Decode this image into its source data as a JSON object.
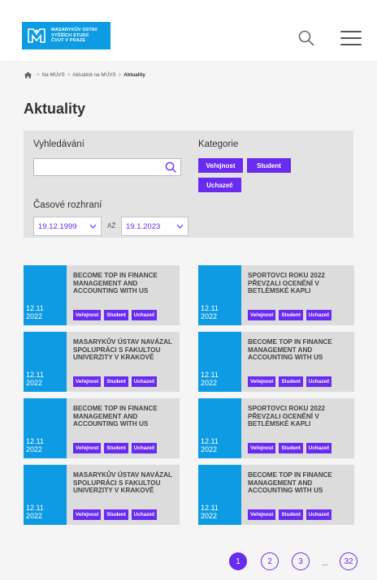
{
  "header": {
    "logo_lines": [
      "MASARYKŮV ÚSTAV",
      "VYŠŠÍCH STUDIÍ",
      "ČVUT V PRAZE"
    ],
    "search_icon": "search-icon",
    "menu_icon": "hamburger-menu-icon"
  },
  "breadcrumb": {
    "items": [
      "Na MÚVS",
      "Aktuálně na MÚVS",
      "Aktuality"
    ],
    "home_icon": "home-icon"
  },
  "page": {
    "title": "Aktuality"
  },
  "filter": {
    "search_label": "Vyhledávání",
    "search_value": "",
    "category_label": "Kategorie",
    "categories": [
      "Veřejnost",
      "Student",
      "Uchazeč"
    ],
    "time_label": "Časové rozhraní",
    "date_from": "19.12.1999",
    "date_to_label": "AŽ",
    "date_to": "19.1.2023"
  },
  "news": [
    {
      "day": "12.11",
      "year": "2022",
      "title": "BECOME TOP IN FINANCE MANAGEMENT AND ACCOUNTING WITH US",
      "tags": [
        "Veřejnost",
        "Student",
        "Uchazeč"
      ]
    },
    {
      "day": "12.11",
      "year": "2022",
      "title": "SPORTOVCI ROKU 2022 PŘEVZALI OCENĚNÍ V BETLÉMSKÉ KAPLI",
      "tags": [
        "Veřejnost",
        "Student",
        "Uchazeč"
      ]
    },
    {
      "day": "12.11",
      "year": "2022",
      "title": "MASARYKŮV ÚSTAV NAVÁZAL SPOLUPRÁCI S FAKULTOU UNIVERZITY V KRAKOVĚ",
      "tags": [
        "Veřejnost",
        "Student",
        "Uchazeč"
      ]
    },
    {
      "day": "12.11",
      "year": "2022",
      "title": "BECOME TOP IN FINANCE MANAGEMENT AND ACCOUNTING WITH US",
      "tags": [
        "Veřejnost",
        "Student",
        "Uchazeč"
      ]
    },
    {
      "day": "12.11",
      "year": "2022",
      "title": "BECOME TOP IN FINANCE MANAGEMENT AND ACCOUNTING WITH US",
      "tags": [
        "Veřejnost",
        "Student",
        "Uchazeč"
      ]
    },
    {
      "day": "12.11",
      "year": "2022",
      "title": "SPORTOVCI ROKU 2022 PŘEVZALI OCENĚNÍ V BETLÉMSKÉ KAPLI",
      "tags": [
        "Veřejnost",
        "Student",
        "Uchazeč"
      ]
    },
    {
      "day": "12.11",
      "year": "2022",
      "title": "MASARYKŮV ÚSTAV NAVÁZAL SPOLUPRÁCI S FAKULTOU UNIVERZITY V KRAKOVĚ",
      "tags": [
        "Veřejnost",
        "Student",
        "Uchazeč"
      ]
    },
    {
      "day": "12.11",
      "year": "2022",
      "title": "BECOME TOP IN FINANCE MANAGEMENT AND ACCOUNTING WITH US",
      "tags": [
        "Veřejnost",
        "Student",
        "Uchazeč"
      ]
    }
  ],
  "pagination": {
    "pages": [
      "1",
      "2",
      "3"
    ],
    "ellipsis": "...",
    "last": "32",
    "current": "1"
  },
  "colors": {
    "brand_blue": "#0d9be3",
    "accent_purple": "#6a2bf0",
    "panel_gray": "#e3e3e3",
    "card_gray": "#dcdcdc"
  }
}
